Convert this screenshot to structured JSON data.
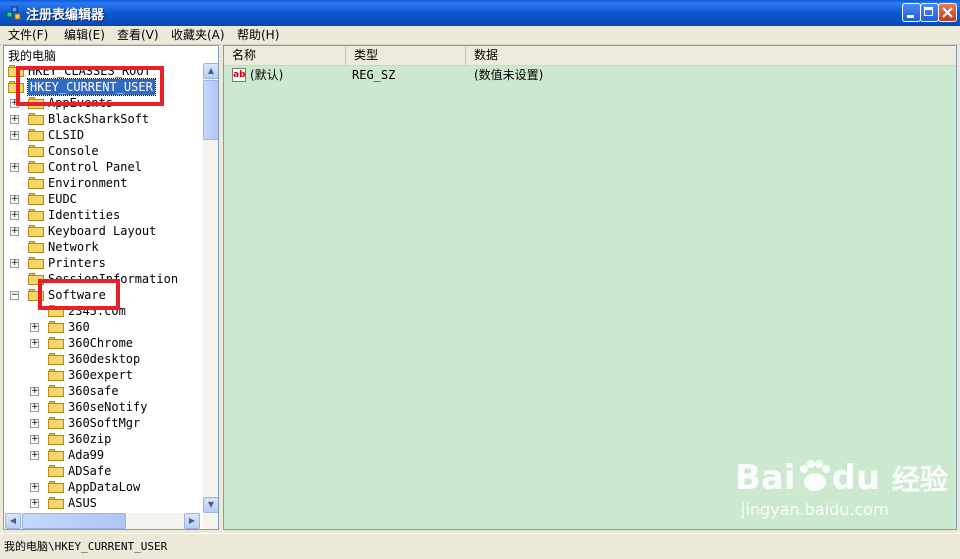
{
  "window": {
    "title": "注册表编辑器"
  },
  "menu": [
    "文件(F)",
    "编辑(E)",
    "查看(V)",
    "收藏夹(A)",
    "帮助(H)"
  ],
  "tree": {
    "root_label": "我的电脑",
    "rows": [
      {
        "label": "HKEY_CLASSES_ROOT"
      },
      {
        "label": "HKEY_CURRENT_USER",
        "selected": true
      },
      {
        "label": "AppEvents"
      },
      {
        "label": "BlackSharkSoft"
      },
      {
        "label": "CLSID"
      },
      {
        "label": "Console"
      },
      {
        "label": "Control Panel"
      },
      {
        "label": "Environment"
      },
      {
        "label": "EUDC"
      },
      {
        "label": "Identities"
      },
      {
        "label": "Keyboard Layout"
      },
      {
        "label": "Network"
      },
      {
        "label": "Printers"
      },
      {
        "label": "SessionInformation"
      },
      {
        "label": "Software"
      },
      {
        "label": "2345.com"
      },
      {
        "label": "360"
      },
      {
        "label": "360Chrome"
      },
      {
        "label": "360desktop"
      },
      {
        "label": "360expert"
      },
      {
        "label": "360safe"
      },
      {
        "label": "360seNotify"
      },
      {
        "label": "360SoftMgr"
      },
      {
        "label": "360zip"
      },
      {
        "label": "Ada99"
      },
      {
        "label": "ADSafe"
      },
      {
        "label": "AppDataLow"
      },
      {
        "label": "ASUS"
      }
    ]
  },
  "list": {
    "columns": [
      "名称",
      "类型",
      "数据"
    ],
    "rows": [
      {
        "name": "(默认)",
        "type": "REG_SZ",
        "data": "(数值未设置)",
        "icon": "string-value-icon"
      }
    ]
  },
  "status": {
    "path": "我的电脑\\HKEY_CURRENT_USER"
  },
  "watermark": {
    "brand": "Bai",
    "brand2": "du",
    "suffix": "经验",
    "url": "jingyan.baidu.com"
  },
  "colors": {
    "list_bg": "#cce8cf",
    "selection": "#316ac5",
    "highlight_box": "#e8202a",
    "titlebar": "#0a5bd8"
  }
}
